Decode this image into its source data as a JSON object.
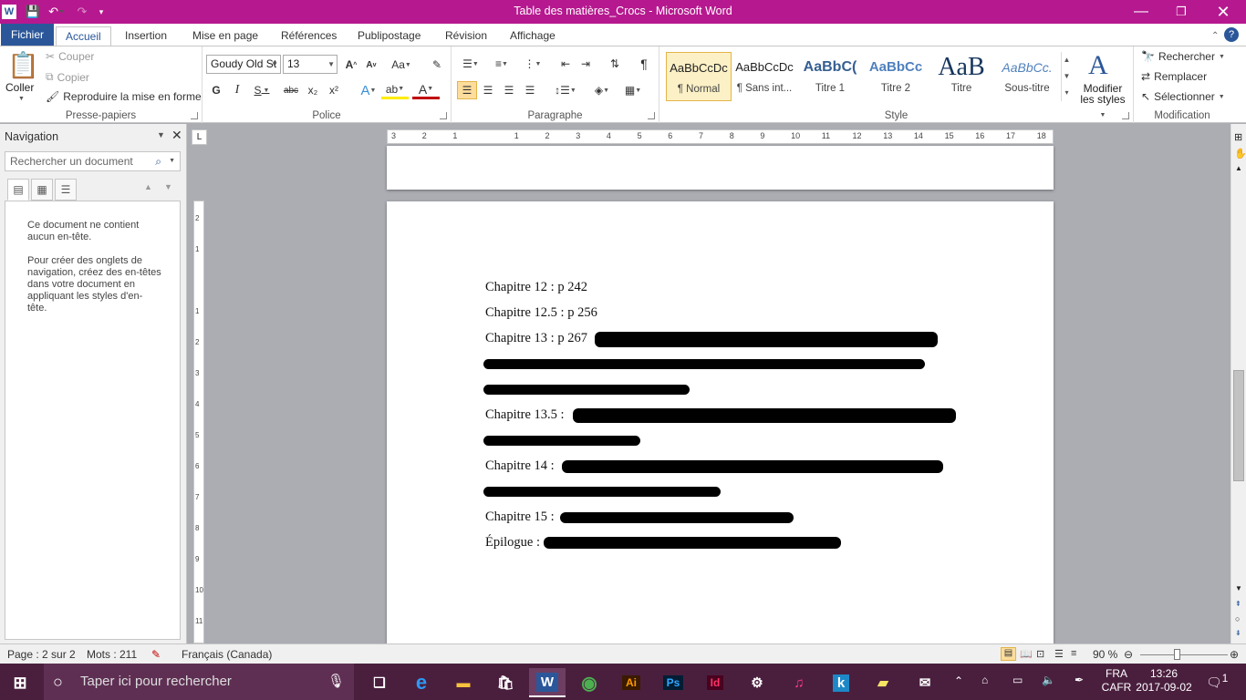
{
  "window": {
    "title": "Table des matières_Crocs  -  Microsoft Word",
    "app_badge": "W"
  },
  "tabs": [
    {
      "label": "Fichier"
    },
    {
      "label": "Accueil"
    },
    {
      "label": "Insertion"
    },
    {
      "label": "Mise en page"
    },
    {
      "label": "Références"
    },
    {
      "label": "Publipostage"
    },
    {
      "label": "Révision"
    },
    {
      "label": "Affichage"
    }
  ],
  "clipboard": {
    "paste": "Coller",
    "cut": "Couper",
    "copy": "Copier",
    "format_painter": "Reproduire la mise en forme",
    "group": "Presse-papiers"
  },
  "font": {
    "name": "Goudy Old St",
    "size": "13",
    "group": "Police"
  },
  "paragraph": {
    "group": "Paragraphe"
  },
  "styles": {
    "group": "Style",
    "items": [
      {
        "preview": "AaBbCcDc",
        "name": "¶ Normal"
      },
      {
        "preview": "AaBbCcDc",
        "name": "¶ Sans int..."
      },
      {
        "preview": "AaBbC(",
        "name": "Titre 1"
      },
      {
        "preview": "AaBbCc",
        "name": "Titre 2"
      },
      {
        "preview": "AaB",
        "name": "Titre"
      },
      {
        "preview": "AaBbCc.",
        "name": "Sous-titre"
      }
    ],
    "change_line1": "Modifier",
    "change_line2": "les styles"
  },
  "editing": {
    "find": "Rechercher",
    "replace": "Remplacer",
    "select": "Sélectionner",
    "group": "Modification"
  },
  "nav": {
    "title": "Navigation",
    "search_placeholder": "Rechercher un document",
    "msg1": "Ce document ne contient aucun en-tête.",
    "msg2": "Pour créer des onglets de navigation, créez des en-têtes dans votre document en appliquant les styles d'en-tête."
  },
  "document": {
    "lines": [
      "Chapitre 12 : p 242",
      "Chapitre 12.5 : p 256",
      "Chapitre 13 : p 267",
      "Chapitre 13.5 :",
      "Chapitre 14 :",
      "Chapitre 15 :",
      "Épilogue :"
    ]
  },
  "status": {
    "page": "Page : 2 sur 2",
    "words": "Mots : 211",
    "language": "Français (Canada)",
    "zoom": "90 %"
  },
  "taskbar": {
    "search": "Taper ici pour rechercher",
    "lang1": "FRA",
    "lang2": "CAFR",
    "time": "13:26",
    "date": "2017-09-02",
    "notif": "1"
  },
  "colors": {
    "accent": "#b6188f",
    "word_blue": "#2b579a",
    "taskbar": "#4a1f3e"
  }
}
